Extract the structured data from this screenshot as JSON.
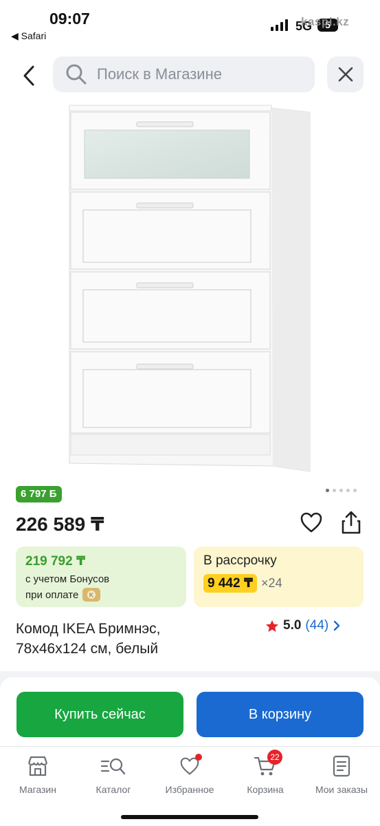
{
  "status_bar": {
    "time": "09:07",
    "back_app": "◀ Safari",
    "network": "5G",
    "battery": "5",
    "watermark": "kaspi.kz"
  },
  "search": {
    "placeholder": "Поиск в Магазине"
  },
  "gallery": {
    "dots_total": 5,
    "active_dot": 1
  },
  "product": {
    "bonus_badge": "6 797 Б",
    "price": "226 589 ₸",
    "title_line1": "Комод IKEA Бримнэс,",
    "title_line2": "78х46х124 см, белый",
    "rating": "5.0",
    "reviews": "(44)"
  },
  "bonus_card": {
    "price": "219 792 ₸",
    "line1": "с учетом Бонусов",
    "line2": "при оплате"
  },
  "installment_card": {
    "title": "В рассрочку",
    "monthly": "9 442 ₸",
    "multiplier": "×24"
  },
  "actions": {
    "buy_now": "Купить сейчас",
    "to_cart": "В корзину"
  },
  "tabbar": {
    "items": [
      {
        "label": "Магазин",
        "icon": "shop-icon"
      },
      {
        "label": "Каталог",
        "icon": "catalog-search-icon"
      },
      {
        "label": "Избранное",
        "icon": "heart-icon"
      },
      {
        "label": "Корзина",
        "icon": "cart-icon"
      },
      {
        "label": "Мои заказы",
        "icon": "orders-icon"
      }
    ],
    "cart_count": "22"
  },
  "colors": {
    "green": "#17a640",
    "blue": "#1a6ad1",
    "bonus_green": "#3aa12f",
    "installment_yellow": "#ffd020",
    "badge_red": "#e5242a"
  }
}
